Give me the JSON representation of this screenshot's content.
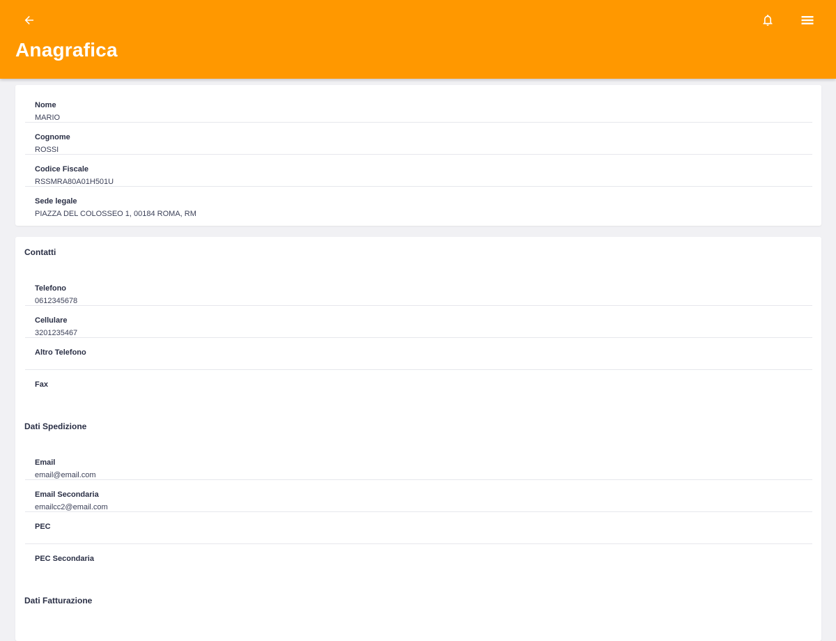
{
  "header": {
    "title": "Anagrafica",
    "back_icon": "arrow-left-icon",
    "notification_icon": "bell-icon",
    "menu_icon": "hamburger-menu-icon",
    "background_color": "#ff9800",
    "text_color": "#ffffff"
  },
  "identity": {
    "fields": [
      {
        "label": "Nome",
        "value": "MARIO"
      },
      {
        "label": "Cognome",
        "value": "ROSSI"
      },
      {
        "label": "Codice Fiscale",
        "value": "RSSMRA80A01H501U"
      },
      {
        "label": "Sede legale",
        "value": "PIAZZA DEL COLOSSEO 1, 00184 ROMA, RM"
      }
    ]
  },
  "contacts": {
    "title": "Contatti",
    "fields": [
      {
        "label": "Telefono",
        "value": "0612345678"
      },
      {
        "label": "Cellulare",
        "value": "3201235467"
      },
      {
        "label": "Altro Telefono",
        "value": ""
      },
      {
        "label": "Fax",
        "value": ""
      }
    ]
  },
  "shipping": {
    "title": "Dati Spedizione",
    "fields": [
      {
        "label": "Email",
        "value": "email@email.com"
      },
      {
        "label": "Email Secondaria",
        "value": "emailcc2@email.com"
      },
      {
        "label": "PEC",
        "value": ""
      },
      {
        "label": "PEC Secondaria",
        "value": ""
      }
    ]
  },
  "billing": {
    "title": "Dati Fatturazione"
  }
}
